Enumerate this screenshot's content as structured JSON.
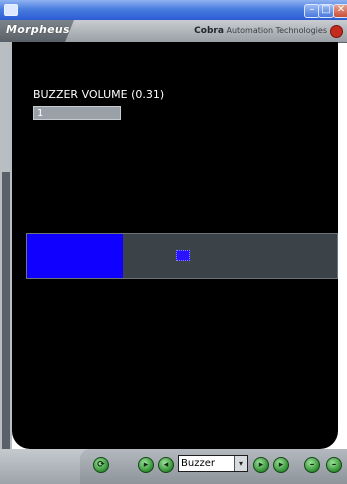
{
  "window": {
    "minimize_glyph": "–",
    "maximize_glyph": "□",
    "close_glyph": "✕"
  },
  "header": {
    "brand": "Morpheus",
    "vendor_name": "Cobra",
    "vendor_tagline": "Automation Technologies"
  },
  "panel": {
    "label": "BUZZER VOLUME (0.31)",
    "value": "1",
    "slider_level": 0.31
  },
  "toolbar": {
    "refresh_icon": "refresh-icon",
    "mode_selected": "Buzzer",
    "dropdown_glyph": "▾",
    "buttons_left": [
      {
        "name": "prev-page-button",
        "glyph": "▸"
      },
      {
        "name": "back-button",
        "glyph": "◂"
      }
    ],
    "buttons_right": [
      {
        "name": "forward-button",
        "glyph": "▸"
      },
      {
        "name": "next-page-button",
        "glyph": "▸"
      },
      {
        "name": "decrease-button",
        "glyph": "–"
      },
      {
        "name": "increase-button",
        "glyph": "–"
      }
    ]
  },
  "colors": {
    "slider_fill": "#1000ff",
    "panel_bg": "#000000",
    "power": "#c52a1e"
  }
}
